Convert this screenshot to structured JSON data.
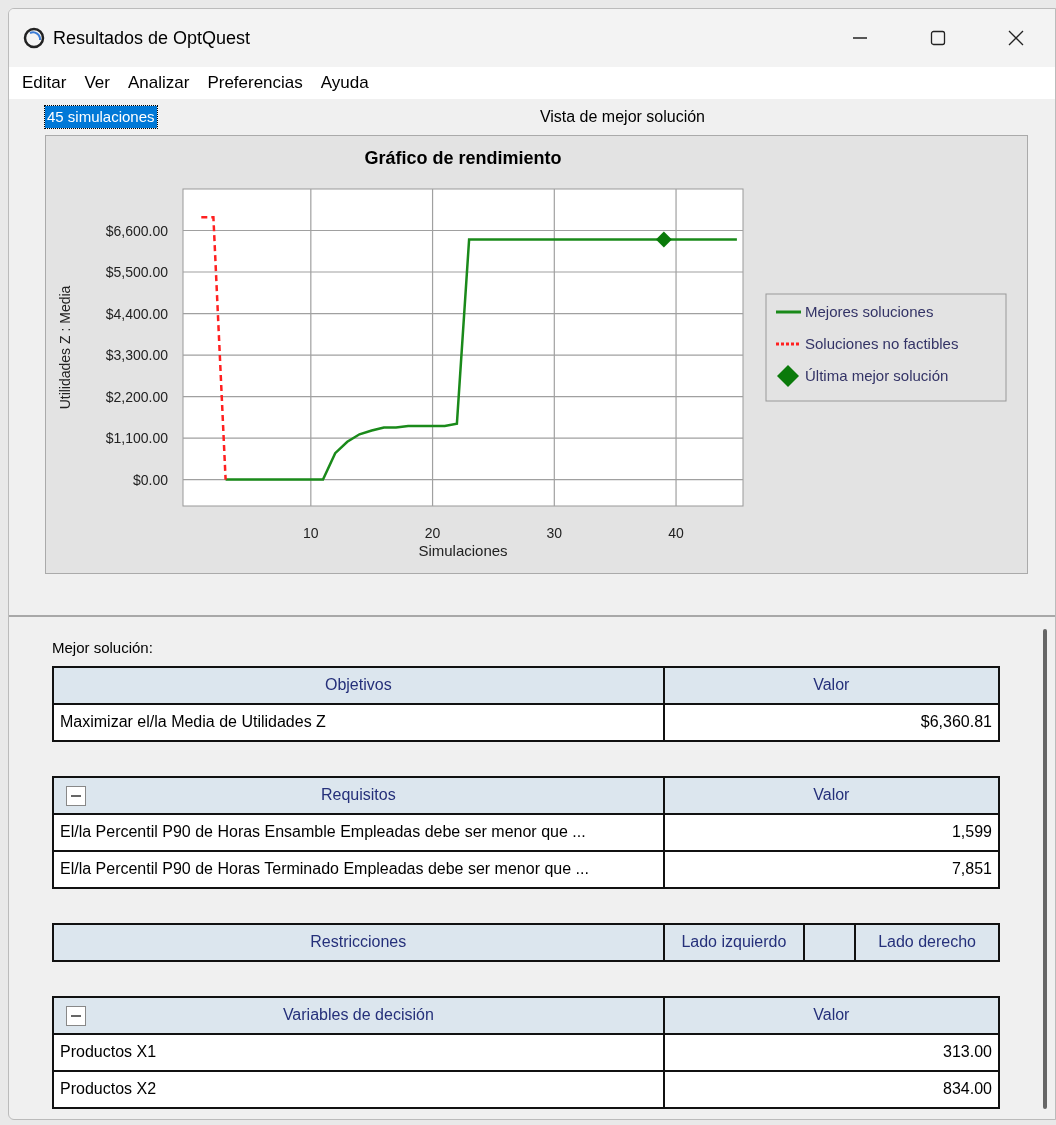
{
  "window": {
    "title": "Resultados de OptQuest"
  },
  "menu": [
    "Editar",
    "Ver",
    "Analizar",
    "Preferencias",
    "Ayuda"
  ],
  "top_pane": {
    "run_count": "45 simulaciones",
    "view_title": "Vista de mejor solución",
    "chart": {
      "chart_data": {
        "type": "line",
        "title": "Gráfico de rendimiento",
        "xlabel": "Simulaciones",
        "ylabel": "Utilidades Z : Media",
        "grid": true,
        "legend": true,
        "x": [
          1,
          2,
          3,
          4,
          5,
          6,
          7,
          8,
          9,
          10,
          11,
          12,
          13,
          14,
          15,
          16,
          17,
          18,
          19,
          20,
          21,
          22,
          23,
          24,
          25,
          26,
          27,
          28,
          29,
          30,
          31,
          32,
          33,
          34,
          35,
          36,
          37,
          38,
          39,
          40,
          41,
          42,
          43,
          44,
          45
        ],
        "series": [
          {
            "name": "Mejores soluciones",
            "color": "#1a8a1a",
            "line_style": "solid",
            "values": [
              null,
              null,
              0,
              0,
              0,
              0,
              0,
              0,
              0,
              0,
              0,
              700,
              1000,
              1200,
              1300,
              1380,
              1380,
              1420,
              1420,
              1420,
              1420,
              1480,
              6360,
              6360,
              6360,
              6360,
              6360,
              6360,
              6360,
              6360,
              6360,
              6360,
              6360,
              6360,
              6360,
              6360,
              6360,
              6360,
              6360,
              6360,
              6360,
              6360,
              6360,
              6360,
              6360
            ]
          },
          {
            "name": "Soluciones no factibles",
            "color": "#ff2020",
            "line_style": "dashed",
            "values": [
              6950,
              6950,
              0,
              null,
              null,
              null,
              null,
              null,
              null,
              null,
              null,
              null,
              null,
              null,
              null,
              null,
              null,
              null,
              null,
              null,
              null,
              null,
              null,
              null,
              null,
              null,
              null,
              null,
              null,
              null,
              null,
              null,
              null,
              null,
              null,
              null,
              null,
              null,
              null,
              null,
              null,
              null,
              null,
              null,
              null
            ]
          },
          {
            "name": "Última mejor solución",
            "color": "#0a7a0a",
            "line_style": "none",
            "marker": "diamond",
            "values": [
              null,
              null,
              null,
              null,
              null,
              null,
              null,
              null,
              null,
              null,
              null,
              null,
              null,
              null,
              null,
              null,
              null,
              null,
              null,
              null,
              null,
              null,
              null,
              null,
              null,
              null,
              null,
              null,
              null,
              null,
              null,
              null,
              null,
              null,
              null,
              null,
              null,
              null,
              6360,
              null,
              null,
              null,
              null,
              null,
              null
            ]
          }
        ],
        "xlim": [
          -0.5,
          45.5
        ],
        "ylim": [
          -700,
          7700
        ],
        "xticks": [
          10,
          20,
          30,
          40
        ],
        "yticks": [
          {
            "value": 0,
            "label": "$0.00"
          },
          {
            "value": 1100,
            "label": "$1,100.00"
          },
          {
            "value": 2200,
            "label": "$2,200.00"
          },
          {
            "value": 3300,
            "label": "$3,300.00"
          },
          {
            "value": 4400,
            "label": "$4,400.00"
          },
          {
            "value": 5500,
            "label": "$5,500.00"
          },
          {
            "value": 6600,
            "label": "$6,600.00"
          }
        ]
      }
    }
  },
  "bottom_pane": {
    "label": "Mejor solución:",
    "tables": [
      {
        "columns": [
          "Objetivos",
          "Valor"
        ],
        "rows": [
          [
            "Maximizar el/la Media de Utilidades Z",
            "$6,360.81"
          ]
        ]
      },
      {
        "expanded": true,
        "columns": [
          "Requisitos",
          "Valor"
        ],
        "rows": [
          [
            "El/la Percentil P90 de Horas Ensamble Empleadas debe ser menor que ...",
            "1,599"
          ],
          [
            "El/la Percentil P90 de Horas Terminado Empleadas debe ser menor que ...",
            "7,851"
          ]
        ]
      },
      {
        "columns": [
          "Restricciones",
          "Lado izquierdo",
          null,
          "Lado derecho"
        ]
      },
      {
        "expanded": true,
        "columns": [
          "Variables de decisión",
          "Valor"
        ],
        "rows": [
          [
            "Productos X1",
            "313.00"
          ],
          [
            "Productos X2",
            "834.00"
          ]
        ]
      }
    ]
  }
}
